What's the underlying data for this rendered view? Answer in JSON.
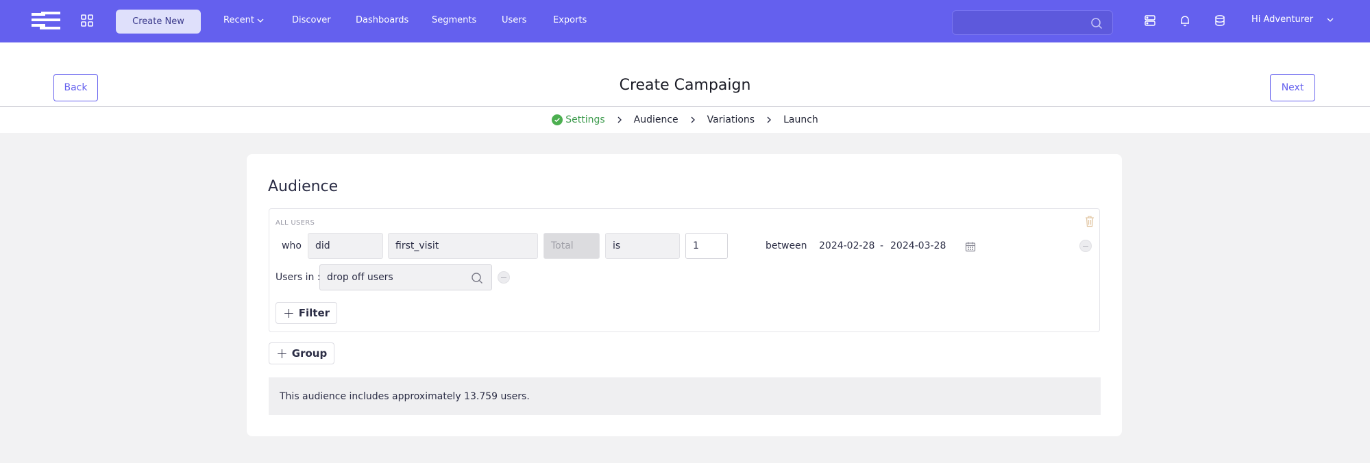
{
  "topbar": {
    "create_label": "Create New",
    "nav": {
      "recent": "Recent",
      "discover": "Discover",
      "dashboards": "Dashboards",
      "segments": "Segments",
      "users": "Users",
      "exports": "Exports"
    },
    "search_placeholder": "",
    "user_greeting": "Hi Adventurer",
    "colors": {
      "bar": "#6460ee",
      "create_button": "#dfe0fb"
    }
  },
  "header": {
    "back_label": "Back",
    "next_label": "Next",
    "title": "Create Campaign",
    "steps": [
      "Settings",
      "Audience",
      "Variations",
      "Launch"
    ],
    "completed_step": "Settings"
  },
  "audience": {
    "title": "Audience",
    "group_label": "ALL USERS",
    "who_label": "who",
    "action": "did",
    "event": "first_visit",
    "aggregate_placeholder": "Total",
    "operator": "is",
    "count": "1",
    "between_label": "between",
    "date_from": "2024-02-28",
    "date_sep": "-",
    "date_to": "2024-03-28",
    "users_in_label": "Users in :",
    "segment": "drop off users",
    "filter_button": "Filter",
    "group_button": "Group",
    "summary": "This audience includes approximately 13.759 users."
  }
}
